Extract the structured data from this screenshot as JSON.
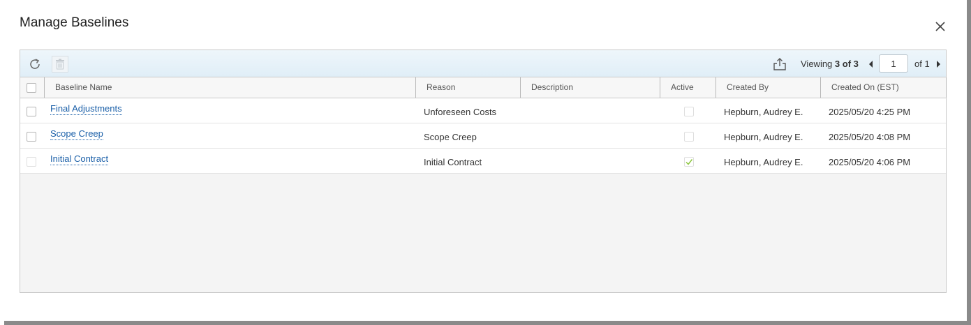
{
  "dialog": {
    "title": "Manage Baselines",
    "close_icon": "close-icon"
  },
  "toolbar": {
    "refresh_icon": "refresh-icon",
    "delete_icon": "trash-icon",
    "export_icon": "export-icon",
    "viewing_label": "Viewing",
    "viewing_count": "3 of 3",
    "page_value": "1",
    "of_pages": "of 1"
  },
  "columns": {
    "baseline_name": "Baseline Name",
    "reason": "Reason",
    "description": "Description",
    "active": "Active",
    "created_by": "Created By",
    "created_on": "Created On (EST)"
  },
  "rows": [
    {
      "name": "Final Adjustments",
      "reason": "Unforeseen Costs",
      "description": "",
      "active": false,
      "created_by": "Hepburn, Audrey E.",
      "created_on": "2025/05/20 4:25 PM"
    },
    {
      "name": "Scope Creep",
      "reason": "Scope Creep",
      "description": "",
      "active": false,
      "created_by": "Hepburn, Audrey E.",
      "created_on": "2025/05/20 4:08 PM"
    },
    {
      "name": "Initial Contract",
      "reason": "Initial Contract",
      "description": "",
      "active": true,
      "created_by": "Hepburn, Audrey E.",
      "created_on": "2025/05/20 4:06 PM"
    }
  ],
  "colors": {
    "link": "#1a5fa8",
    "toolbar_bg": "#e0eef7",
    "check": "#8cc63f"
  }
}
